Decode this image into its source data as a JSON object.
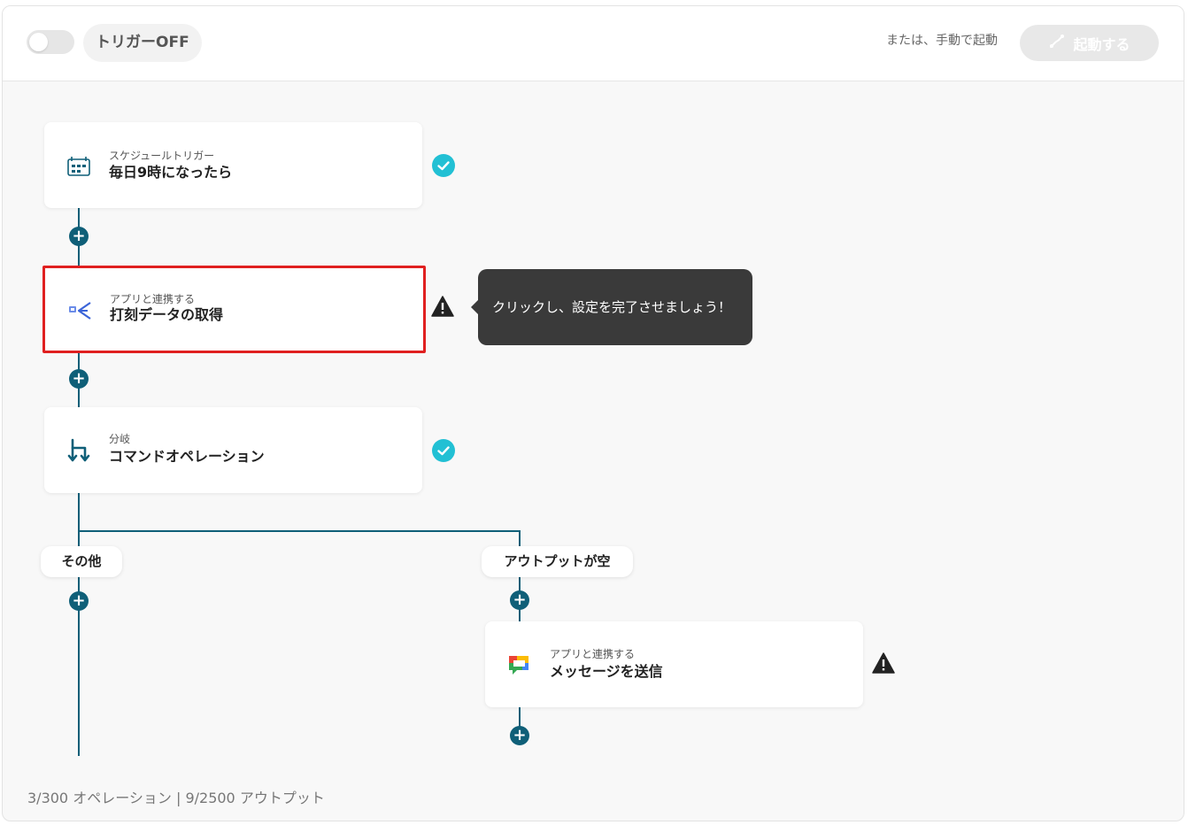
{
  "header": {
    "trigger_label": "トリガーOFF",
    "manual_text": "または、手動で起動",
    "start_button_label": "起動する"
  },
  "flow": {
    "step1": {
      "subtitle": "スケジュールトリガー",
      "title": "毎日9時になったら",
      "icon": "calendar-clock-icon",
      "status": "complete"
    },
    "step2": {
      "subtitle": "アプリと連携する",
      "title": "打刻データの取得",
      "icon": "attendance-app-icon",
      "status": "warning"
    },
    "step3": {
      "subtitle": "分岐",
      "title": "コマンドオペレーション",
      "icon": "branch-icon",
      "status": "complete"
    },
    "branches": [
      "その他",
      "アウトプットが空"
    ],
    "step4": {
      "subtitle": "アプリと連携する",
      "title": "メッセージを送信",
      "icon": "google-chat-icon",
      "status": "warning"
    }
  },
  "tooltip": {
    "text": "クリックし、設定を完了させましょう！"
  },
  "footer": {
    "usage": "3/300 オペレーション | 9/2500 アウトプット"
  },
  "colors": {
    "accent": "#0f5f78",
    "check": "#22c0d4",
    "selected_border": "#e02020",
    "tooltip_bg": "#3a3a3a"
  }
}
